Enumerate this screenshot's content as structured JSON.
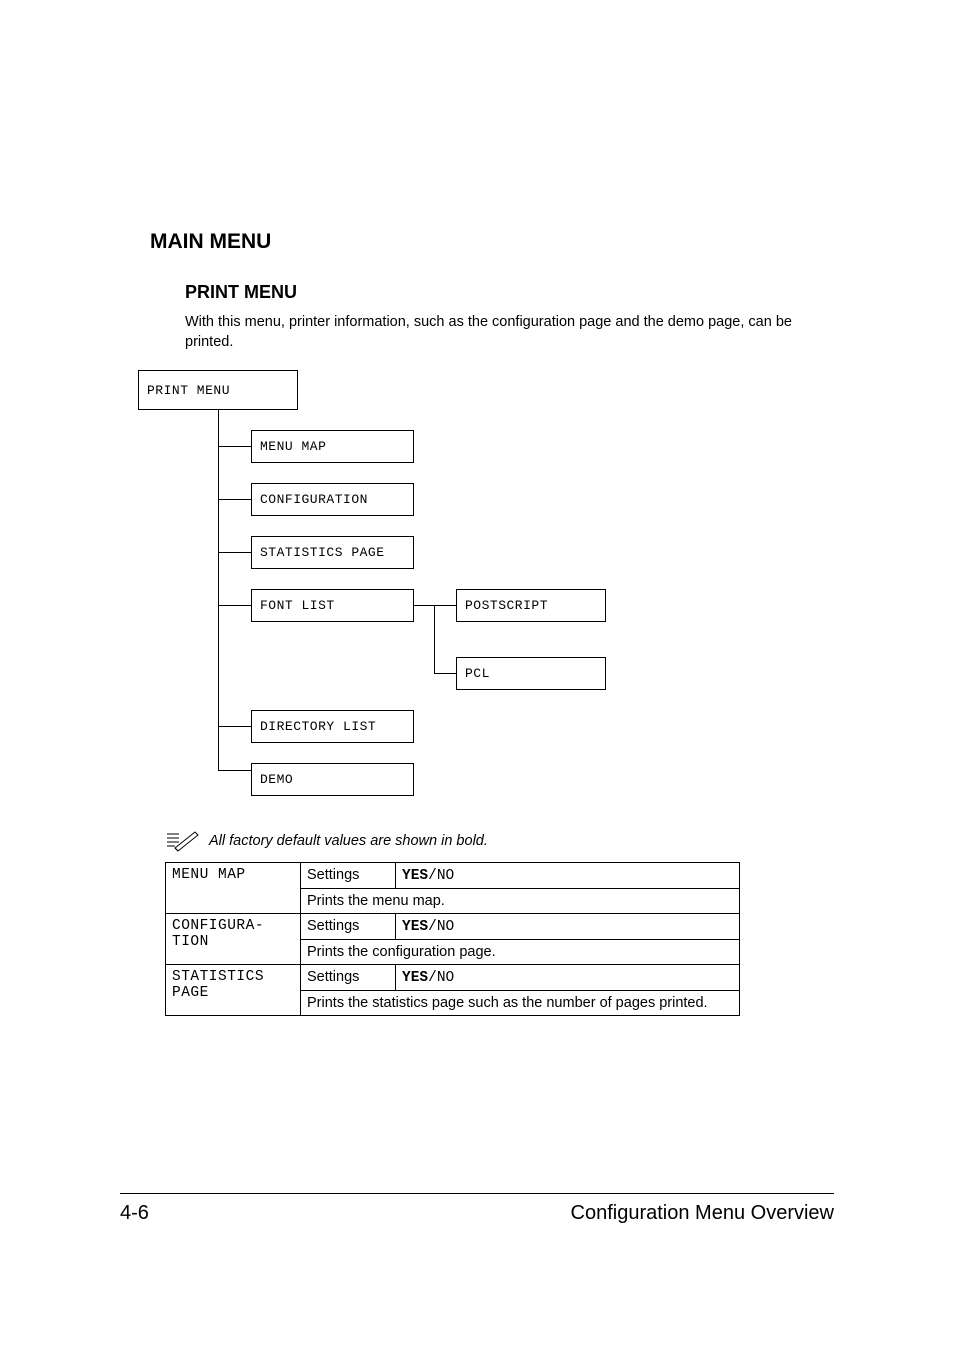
{
  "headings": {
    "main": "MAIN MENU",
    "sub": "PRINT MENU"
  },
  "intro": "With this menu, printer information, such as the configuration page and the demo page, can be printed.",
  "diagram": {
    "root": "PRINT MENU",
    "items": {
      "menu_map": "MENU MAP",
      "configuration": "CONFIGURATION",
      "statistics_page": "STATISTICS PAGE",
      "font_list": "FONT LIST",
      "directory_list": "DIRECTORY LIST",
      "demo": "DEMO"
    },
    "fontlist_children": {
      "postscript": "POSTSCRIPT",
      "pcl": "PCL"
    }
  },
  "note": "All factory default values are shown in bold.",
  "table": {
    "settings_label": "Settings",
    "rows": {
      "menu_map": {
        "name": "MENU MAP",
        "value_bold": "YES",
        "value_sep": "/",
        "value_rest": "NO",
        "desc": "Prints the menu map."
      },
      "configura": {
        "name_line1": "CONFIGURA-",
        "name_line2": "TION",
        "value_bold": "YES",
        "value_sep": "/",
        "value_rest": "NO",
        "desc": "Prints the configuration page."
      },
      "statistics": {
        "name_line1": "STATISTICS",
        "name_line2": "PAGE",
        "value_bold": "YES",
        "value_sep": "/",
        "value_rest": "NO",
        "desc": "Prints the statistics page such as the number of pages printed."
      }
    }
  },
  "footer": {
    "page": "4-6",
    "section": "Configuration Menu Overview"
  }
}
